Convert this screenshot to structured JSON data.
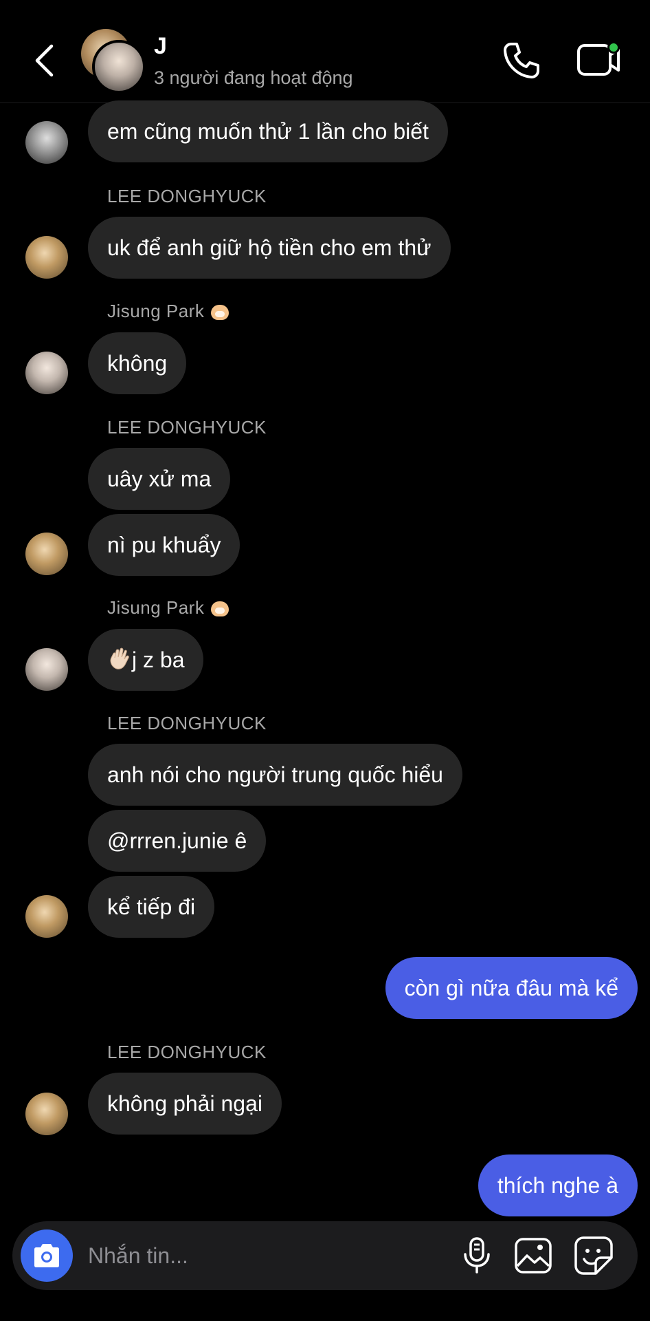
{
  "header": {
    "title": "J",
    "subtitle": "3 người đang hoạt động",
    "online_color": "#31c44c"
  },
  "senders": {
    "lee": "LEE DONGHYUCK",
    "jisung": "Jisung Park"
  },
  "messages": {
    "m1": "em cũng muốn thử 1 lần cho biết",
    "m2": "uk để anh giữ hộ tiền cho em thử",
    "m3": "không",
    "m4": "uây xử ma",
    "m5": "nì pu khuẩy",
    "m6": "j z ba",
    "m7": "anh nói cho người trung quốc hiểu",
    "m8": "@rrren.junie ê",
    "m9": "kể tiếp đi",
    "m10": "còn gì nữa đâu mà kể",
    "m11": "không phải ngại",
    "m12": "thích nghe à"
  },
  "composer": {
    "placeholder": "Nhắn tin..."
  },
  "colors": {
    "incoming_bubble": "#262626",
    "outgoing_bubble": "#4a5ee5",
    "camera_button": "#3d6bef"
  },
  "icons": [
    "back-chevron-icon",
    "phone-icon",
    "video-call-icon",
    "camera-icon",
    "microphone-icon",
    "gallery-icon",
    "sticker-icon",
    "hamster-emoji",
    "waving-hand-emoji"
  ]
}
